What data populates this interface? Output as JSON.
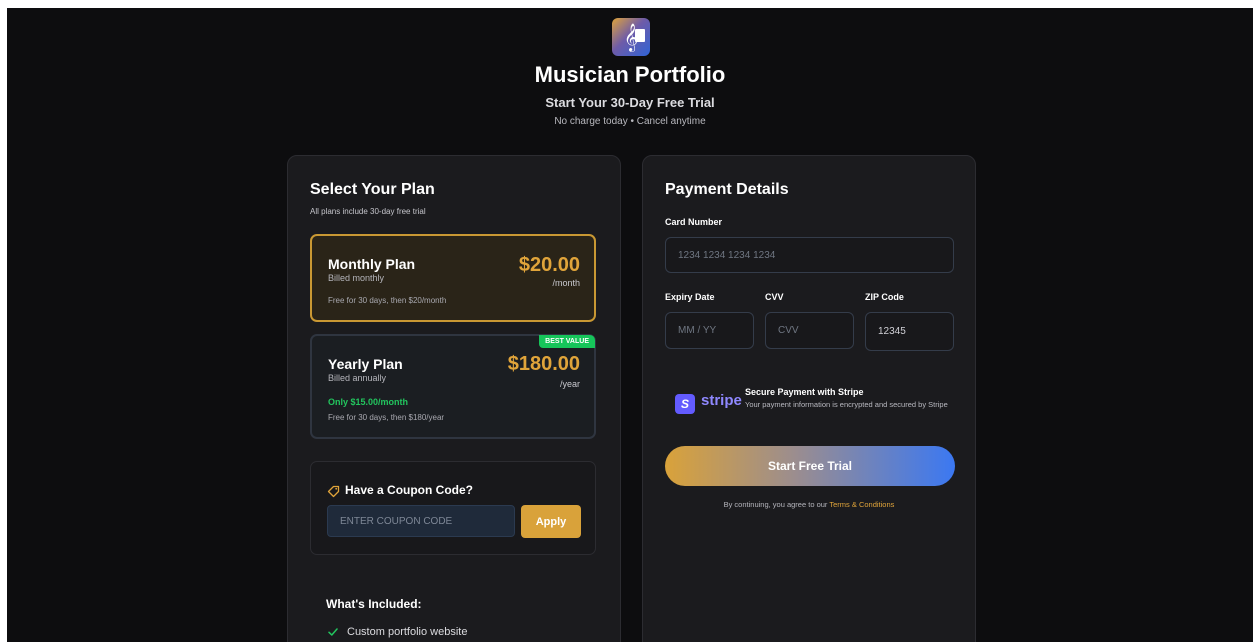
{
  "header": {
    "logo_icon": "treble-clef-icon",
    "title": "Musician Portfolio",
    "subtitle": "Start Your 30-Day Free Trial",
    "note": "No charge today • Cancel anytime"
  },
  "plans": {
    "heading": "Select Your Plan",
    "subheading": "All plans include 30-day free trial",
    "monthly": {
      "name": "Monthly Plan",
      "billed": "Billed monthly",
      "price": "$20.00",
      "period": "/month",
      "footnote": "Free for 30 days, then $20/month",
      "selected": true
    },
    "yearly": {
      "name": "Yearly Plan",
      "billed": "Billed annually",
      "price": "$180.00",
      "period": "/year",
      "badge": "BEST VALUE",
      "monthly_equiv": "Only $15.00/month",
      "footnote": "Free for 30 days, then $180/year"
    }
  },
  "coupon": {
    "title": "Have a Coupon Code?",
    "placeholder": "ENTER COUPON CODE",
    "apply_label": "Apply"
  },
  "included": {
    "title": "What's Included:",
    "items": [
      "Custom portfolio website"
    ]
  },
  "payment": {
    "heading": "Payment Details",
    "card_label": "Card Number",
    "card_placeholder": "1234 1234 1234 1234",
    "expiry_label": "Expiry Date",
    "expiry_placeholder": "MM / YY",
    "cvv_label": "CVV",
    "cvv_placeholder": "CVV",
    "zip_label": "ZIP Code",
    "zip_value": "12345",
    "stripe_word": "stripe",
    "stripe_letter": "S",
    "secure_title": "Secure Payment with Stripe",
    "secure_text": "Your payment information is encrypted and secured by Stripe",
    "cta_label": "Start Free Trial",
    "terms_prefix": "By continuing, you agree to our",
    "terms_link": "Terms & Conditions"
  },
  "colors": {
    "accent_gold": "#e0a43a",
    "accent_blue": "#3b78f2",
    "success_green": "#22c55e",
    "stripe_purple": "#635bff"
  }
}
